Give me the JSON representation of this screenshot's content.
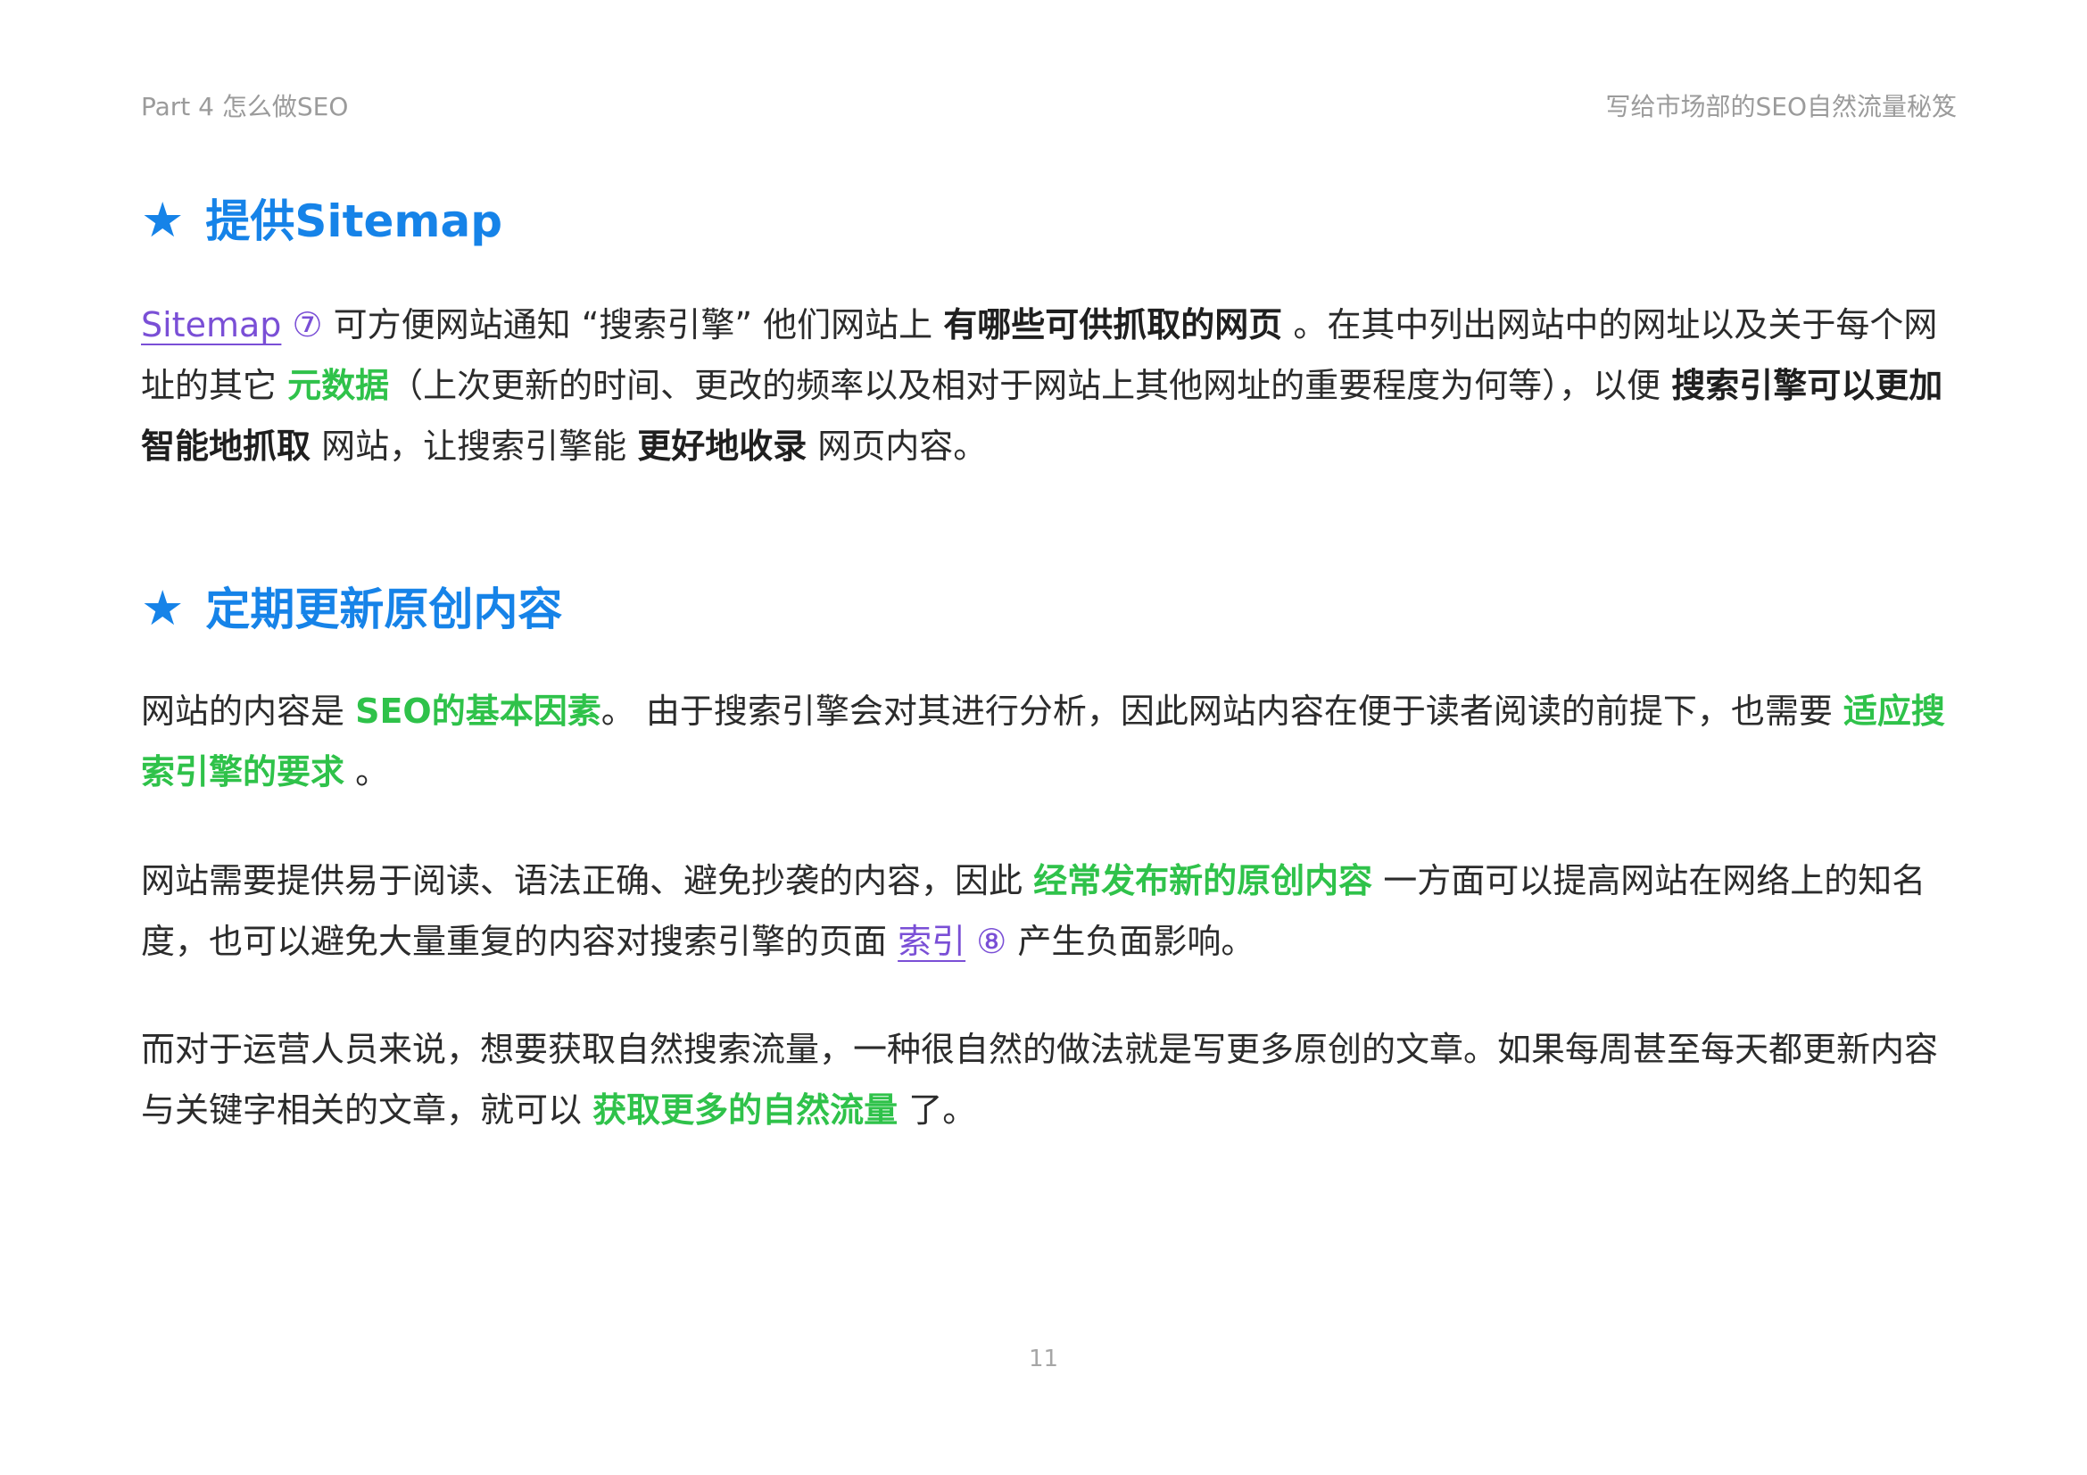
{
  "header": {
    "left": "Part 4  怎么做SEO",
    "right": "写给市场部的SEO自然流量秘笈"
  },
  "icons": {
    "heading_marker": "star-icon",
    "star_glyph": "★"
  },
  "colors": {
    "heading": "#1683e8",
    "highlight_green": "#2fc24a",
    "link_purple": "#7a4fd6"
  },
  "section_sitemap": {
    "heading": "提供Sitemap",
    "paragraph": {
      "link_sitemap": "Sitemap",
      "ref_7": "⑦",
      "t1": " 可方便网站通知 “搜索引擎” 他们网站上 ",
      "b1": "有哪些可供抓取的网页",
      "t2": " 。在其中列出网站中的网址以及关于每个网址的其它 ",
      "g1": "元数据",
      "t3": "（上次更新的时间、更改的频率以及相对于网站上其他网址的重要程度为何等），以便 ",
      "b2": "搜索引擎可以更加智能地抓取",
      "t4": " 网站，让搜索引擎能 ",
      "b3": "更好地收录",
      "t5": " 网页内容。"
    }
  },
  "section_content": {
    "heading": "定期更新原创内容",
    "paragraph_1": {
      "t1": "网站的内容是 ",
      "g1": "SEO的基本因素",
      "t2": "。 由于搜索引擎会对其进行分析，因此网站内容在便于读者阅读的前提下，也需要 ",
      "g2": "适应搜索引擎的要求",
      "t3": " 。"
    },
    "paragraph_2": {
      "t1": "网站需要提供易于阅读、语法正确、避免抄袭的内容，因此 ",
      "g1": "经常发布新的原创内容",
      "t2": " 一方面可以提高网站在网络上的知名度，也可以避免大量重复的内容对搜索引擎的页面 ",
      "link_index": "索引",
      "ref_8": "⑧",
      "t3": " 产生负面影响。"
    },
    "paragraph_3": {
      "t1": "而对于运营人员来说，想要获取自然搜索流量，一种很自然的做法就是写更多原创的文章。如果每周甚至每天都更新内容与关键字相关的文章，就可以 ",
      "g1": "获取更多的自然流量",
      "t2": " 了。"
    }
  },
  "footer": {
    "page_number": "11"
  }
}
